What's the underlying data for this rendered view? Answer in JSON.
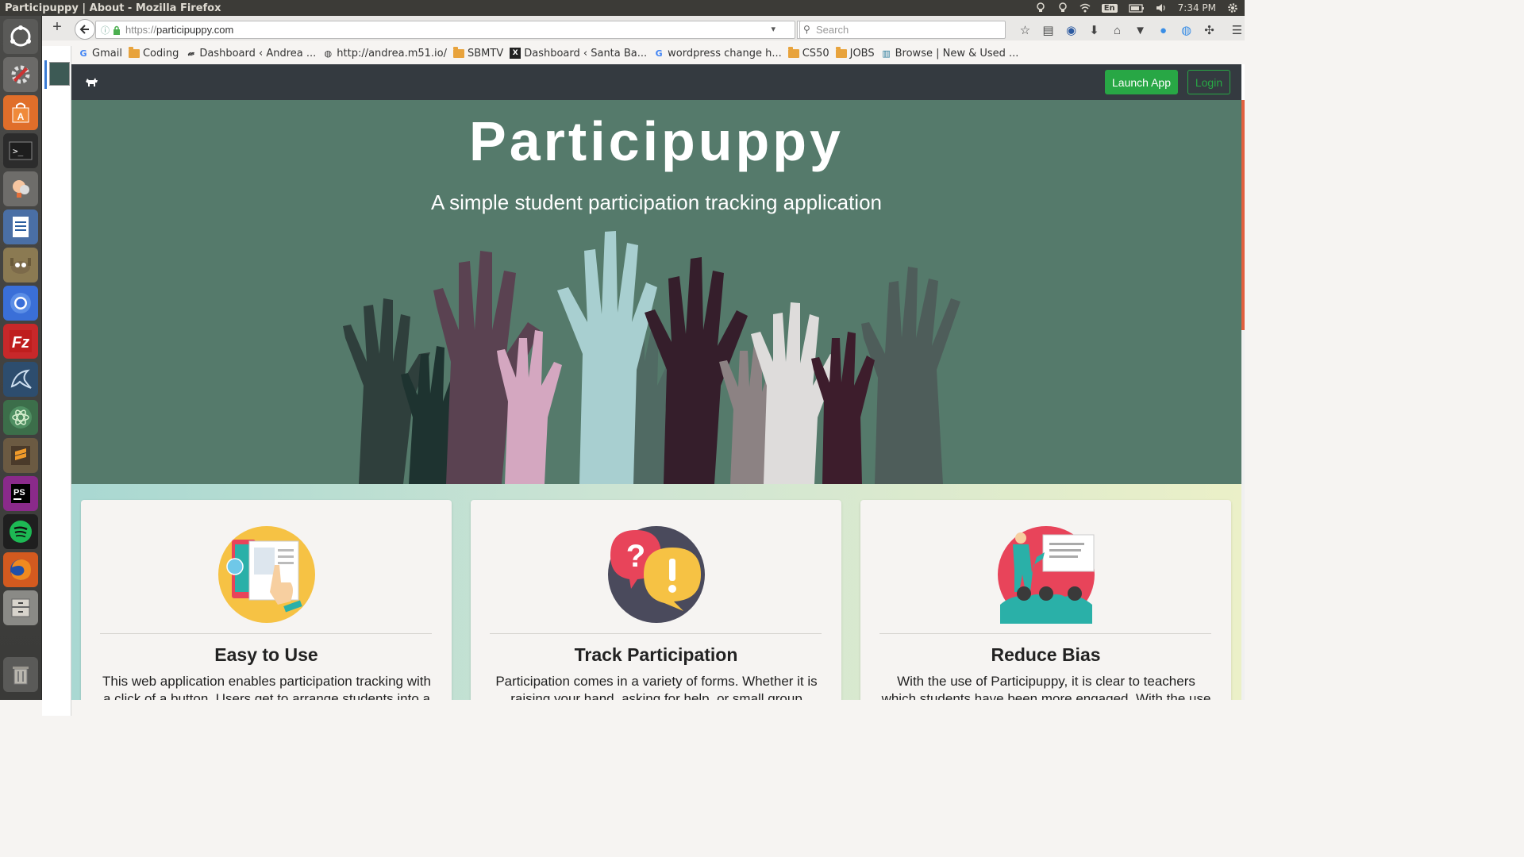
{
  "os_panel": {
    "window_title": "Participuppy | About - Mozilla Firefox",
    "keyboard_layout": "En",
    "clock": "7:34 PM",
    "tray_icons": [
      "lightbulb-icon",
      "lightbulb-icon",
      "wifi-icon",
      "keyboard-layout",
      "battery-icon",
      "volume-icon",
      "clock",
      "gear-icon"
    ]
  },
  "launcher": {
    "items": [
      "dash-home",
      "system-settings",
      "software-center",
      "terminal",
      "idea-app",
      "libreoffice-writer",
      "gimp",
      "chromium",
      "filezilla",
      "mysql-workbench",
      "atom",
      "sublime-text",
      "phpstorm",
      "spotify",
      "firefox",
      "files",
      "trash"
    ]
  },
  "browser": {
    "new_tab_label": "+",
    "url_scheme": "https://",
    "url_host": "participuppy.com",
    "search_placeholder": "Search",
    "bookmarks": [
      {
        "label": "Gmail",
        "icon": "google-icon"
      },
      {
        "label": "Coding",
        "icon": "folder-icon"
      },
      {
        "label": "Dashboard ‹ Andrea ...",
        "icon": "wordpress-icon"
      },
      {
        "label": "http://andrea.m51.io/",
        "icon": "globe-icon"
      },
      {
        "label": "SBMTV",
        "icon": "folder-icon"
      },
      {
        "label": "Dashboard ‹ Santa Ba...",
        "icon": "x-icon"
      },
      {
        "label": "wordpress change h...",
        "icon": "google-icon"
      },
      {
        "label": "CS50",
        "icon": "folder-icon"
      },
      {
        "label": "JOBS",
        "icon": "folder-icon"
      },
      {
        "label": "Browse | New & Used ...",
        "icon": "library-icon"
      }
    ]
  },
  "site": {
    "nav": {
      "launch_label": "Launch App",
      "login_label": "Login"
    },
    "hero": {
      "title": "Participuppy",
      "subtitle": "A simple student participation tracking application"
    },
    "features": [
      {
        "title": "Easy to Use",
        "text": "This web application enables participation tracking with a click of a button. Users get to arrange students into a"
      },
      {
        "title": "Track Participation",
        "text": "Participation comes in a variety of forms. Whether it is raising your hand, asking for help, or small group"
      },
      {
        "title": "Reduce Bias",
        "text": "With the use of Participuppy, it is clear to teachers which students have been more engaged. With the use of"
      }
    ]
  },
  "colors": {
    "hero_bg": "#557a6b",
    "navbar_bg": "#343a40",
    "accent_green": "#28a745",
    "card_bg": "#f6f4f2"
  }
}
